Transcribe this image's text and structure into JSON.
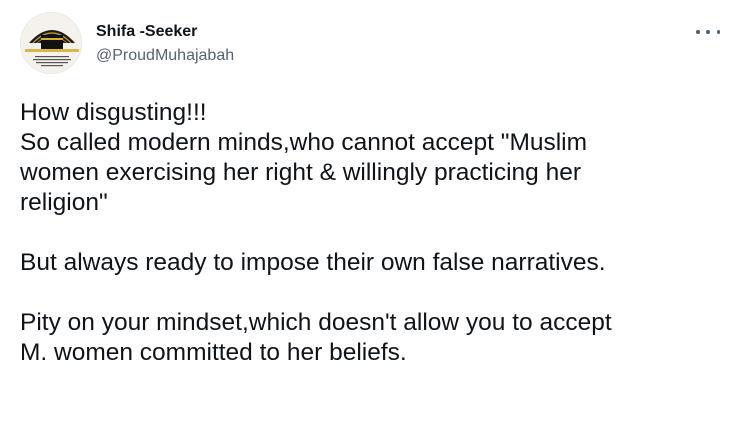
{
  "author": {
    "display_name": "Shifa -Seeker",
    "handle": "@ProudMuhajabah"
  },
  "more_icon": "more-horizontal-icon",
  "tweet": {
    "paragraphs": [
      {
        "lines": [
          "How disgusting!!!",
          "So called modern minds,who cannot accept \"Muslim",
          "women exercising her right & willingly practicing her",
          "religion\""
        ]
      },
      {
        "lines": [
          "But always ready to impose their own false narratives."
        ]
      },
      {
        "lines": [
          "Pity on your mindset,which doesn't allow you to accept",
          "M. women committed to her beliefs."
        ]
      }
    ]
  }
}
